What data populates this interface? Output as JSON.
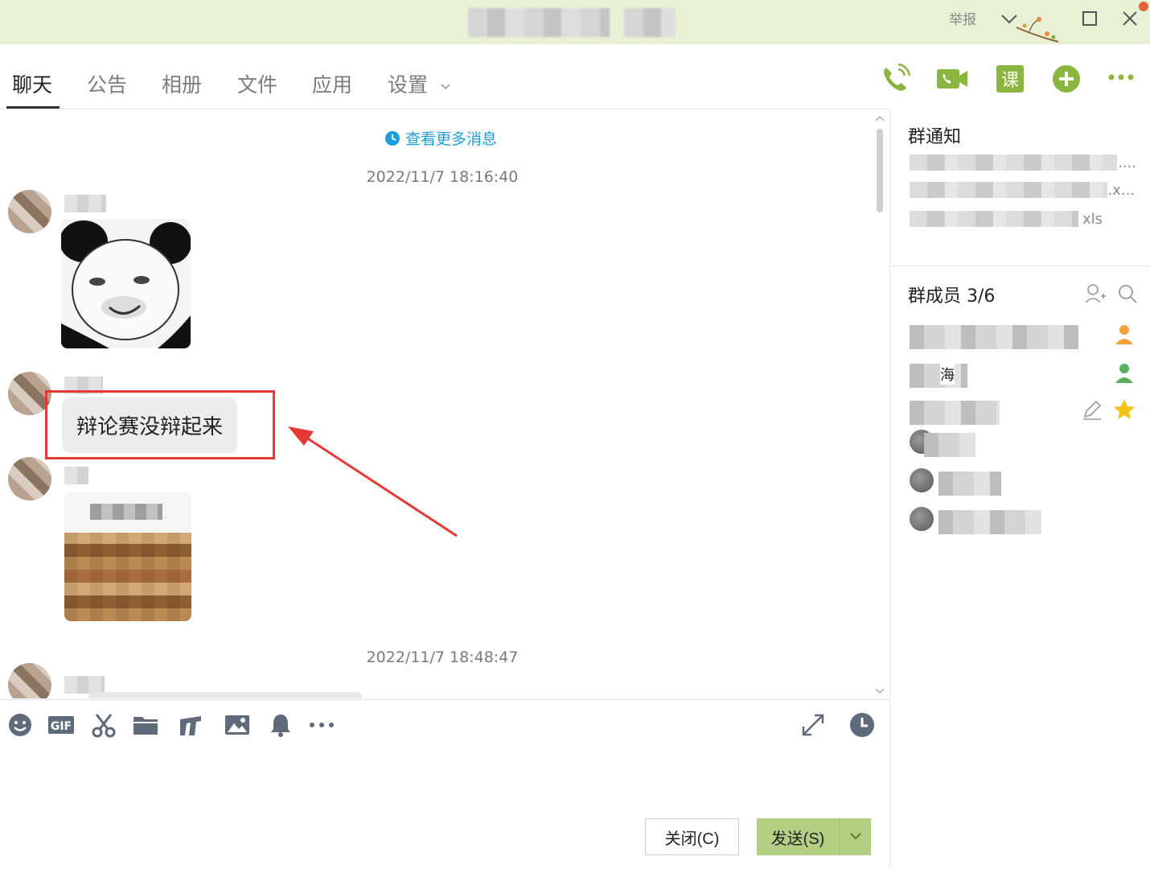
{
  "window": {
    "report_label": "举报",
    "colors": {
      "titlebar": "#e8f1d4",
      "accent": "#8ab63f",
      "link": "#1e9ede",
      "highlight": "#e53935"
    }
  },
  "tabs": [
    {
      "label": "聊天"
    },
    {
      "label": "公告"
    },
    {
      "label": "相册"
    },
    {
      "label": "文件"
    },
    {
      "label": "应用"
    },
    {
      "label": "设置"
    }
  ],
  "chat": {
    "view_more": "查看更多消息",
    "timestamps": [
      "2022/11/7 18:16:40",
      "2022/11/7 18:48:47"
    ],
    "messages": [
      {
        "type": "sticker"
      },
      {
        "type": "text",
        "text": "辩论赛没辩起来"
      },
      {
        "type": "image"
      }
    ]
  },
  "buttons": {
    "close": "关闭(C)",
    "send": "发送(S)"
  },
  "sidebar": {
    "notice_title": "群通知",
    "files": [
      {
        "suffix": "...."
      },
      {
        "suffix": ".x..."
      },
      {
        "suffix": "xls"
      }
    ],
    "members_title": "群成员 3/6",
    "members": [
      {
        "fragment": ""
      },
      {
        "fragment": "海"
      },
      {
        "fragment": ""
      },
      {
        "fragment": ""
      },
      {
        "fragment": ""
      },
      {
        "fragment": ""
      }
    ]
  }
}
